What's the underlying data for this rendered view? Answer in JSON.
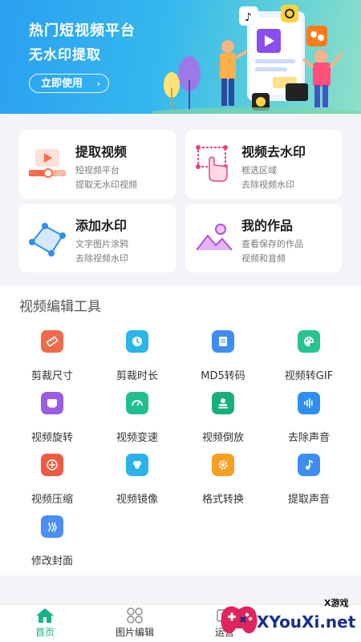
{
  "banner": {
    "title": "热门短视频平台",
    "subtitle": "无水印提取",
    "button_label": "立即使用"
  },
  "cards": [
    {
      "title": "提取视频",
      "desc1": "短视频平台",
      "desc2": "提取无水印视频",
      "icon": "video-extract-icon"
    },
    {
      "title": "视频去水印",
      "desc1": "框选区域",
      "desc2": "去除视频水印",
      "icon": "select-area-icon"
    },
    {
      "title": "添加水印",
      "desc1": "文字图片涂鸦",
      "desc2": "去除视频水印",
      "icon": "add-watermark-icon"
    },
    {
      "title": "我的作品",
      "desc1": "查看保存的作品",
      "desc2": "视频和音频",
      "icon": "my-works-icon"
    }
  ],
  "tools": {
    "title": "视频编辑工具",
    "items": [
      {
        "label": "剪裁尺寸",
        "icon": "ruler-icon",
        "color": "#f06a4a"
      },
      {
        "label": "剪裁时长",
        "icon": "clock-icon",
        "color": "#29b6e8"
      },
      {
        "label": "MD5转码",
        "icon": "document-icon",
        "color": "#3d8ef0"
      },
      {
        "label": "视频转GIF",
        "icon": "palette-icon",
        "color": "#27c48f"
      },
      {
        "label": "视频旋转",
        "icon": "rotate-icon",
        "color": "#9b5de5"
      },
      {
        "label": "视频变速",
        "icon": "speedometer-icon",
        "color": "#1fbf8f"
      },
      {
        "label": "视频倒放",
        "icon": "stamp-icon",
        "color": "#17b07c"
      },
      {
        "label": "去除声音",
        "icon": "soundwave-icon",
        "color": "#2f8ff0"
      },
      {
        "label": "视频压缩",
        "icon": "compress-icon",
        "color": "#f05a40"
      },
      {
        "label": "视频镜像",
        "icon": "mirror-icon",
        "color": "#29b3ea"
      },
      {
        "label": "格式转换",
        "icon": "gear-icon",
        "color": "#f5a020"
      },
      {
        "label": "提取声音",
        "icon": "music-note-icon",
        "color": "#3d8ef0"
      },
      {
        "label": "修改封面",
        "icon": "cover-icon",
        "color": "#4b8ef5"
      }
    ]
  },
  "nav": {
    "items": [
      {
        "label": "首页",
        "icon": "home-icon",
        "active": true
      },
      {
        "label": "图片编辑",
        "icon": "image-edit-icon",
        "active": false
      },
      {
        "label": "运营",
        "icon": "operations-icon",
        "active": false
      }
    ],
    "active_color": "#17b388"
  },
  "watermark": {
    "site": "XYouXi.net",
    "cn": "X游戏"
  },
  "colors": {
    "banner_start": "#2aa0f0",
    "banner_end": "#8fe0c8",
    "page_bg": "#f3f4f7"
  }
}
